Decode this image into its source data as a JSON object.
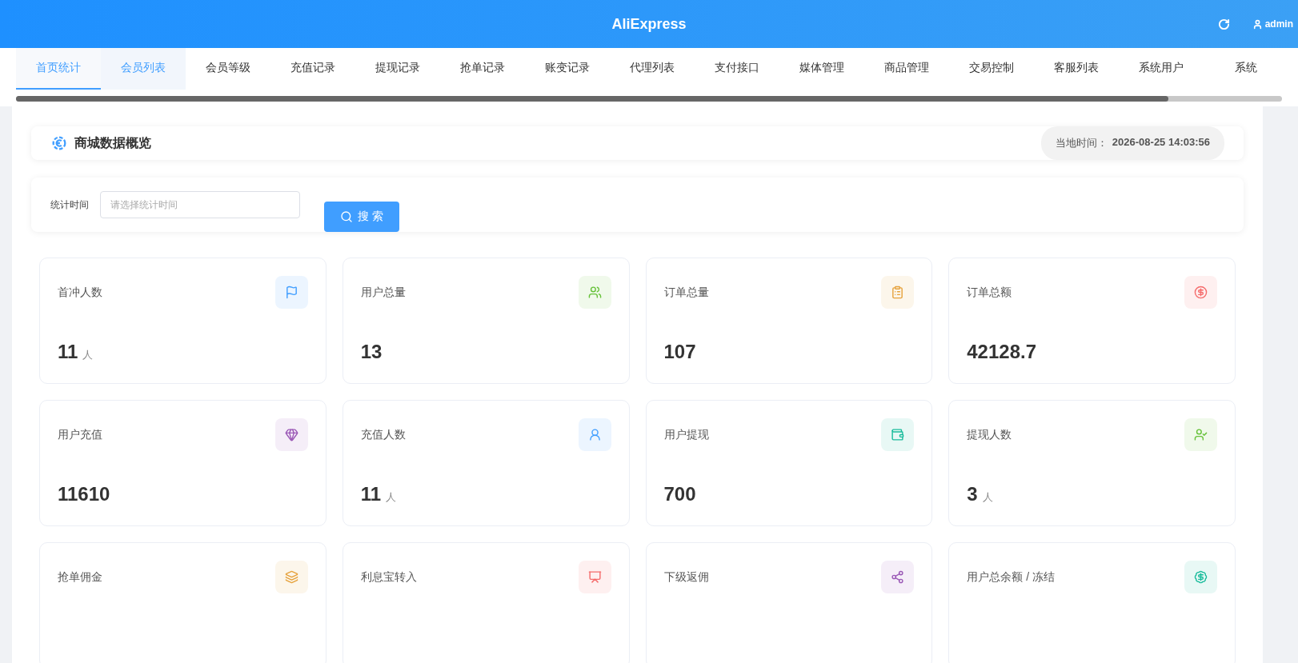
{
  "header": {
    "title": "AliExpress",
    "user": "admin"
  },
  "tabs": [
    {
      "label": "首页统计",
      "selected": true,
      "highlighted": false
    },
    {
      "label": "会员列表",
      "selected": false,
      "highlighted": true
    },
    {
      "label": "会员等级",
      "selected": false,
      "highlighted": false
    },
    {
      "label": "充值记录",
      "selected": false,
      "highlighted": false
    },
    {
      "label": "提现记录",
      "selected": false,
      "highlighted": false
    },
    {
      "label": "抢单记录",
      "selected": false,
      "highlighted": false
    },
    {
      "label": "账变记录",
      "selected": false,
      "highlighted": false
    },
    {
      "label": "代理列表",
      "selected": false,
      "highlighted": false
    },
    {
      "label": "支付接口",
      "selected": false,
      "highlighted": false
    },
    {
      "label": "媒体管理",
      "selected": false,
      "highlighted": false
    },
    {
      "label": "商品管理",
      "selected": false,
      "highlighted": false
    },
    {
      "label": "交易控制",
      "selected": false,
      "highlighted": false
    },
    {
      "label": "客服列表",
      "selected": false,
      "highlighted": false
    },
    {
      "label": "系统用户",
      "selected": false,
      "highlighted": false
    },
    {
      "label": "系统",
      "selected": false,
      "highlighted": false
    }
  ],
  "overview": {
    "title": "商城数据概览",
    "time_label": "当地时间：",
    "time": "2026-08-25 14:03:56"
  },
  "filter": {
    "label": "统计时间",
    "placeholder": "请选择统计时间",
    "button": "搜 索"
  },
  "cards": [
    {
      "label": "首冲人数",
      "value": "11",
      "unit": "人",
      "color": "#409eff"
    },
    {
      "label": "用户总量",
      "value": "13",
      "color": "#67c23a"
    },
    {
      "label": "订单总量",
      "value": "107",
      "color": "#e6a23c"
    },
    {
      "label": "订单总额",
      "value": "42128.7",
      "color": "#f56c6c"
    },
    {
      "label": "用户充值",
      "value": "11610",
      "color": "#9b59b6"
    },
    {
      "label": "充值人数",
      "value": "11",
      "unit": "人",
      "color": "#409eff"
    },
    {
      "label": "用户提现",
      "value": "700",
      "color": "#1abc9c"
    },
    {
      "label": "提现人数",
      "value": "3",
      "unit": "人",
      "color": "#67c23a"
    },
    {
      "label": "抢单佣金",
      "color": "#e6a23c"
    },
    {
      "label": "利息宝转入",
      "color": "#f56c6c"
    },
    {
      "label": "下级返佣",
      "color": "#9b59b6"
    },
    {
      "label": "用户总余额 / 冻结",
      "color": "#1abc9c"
    }
  ]
}
